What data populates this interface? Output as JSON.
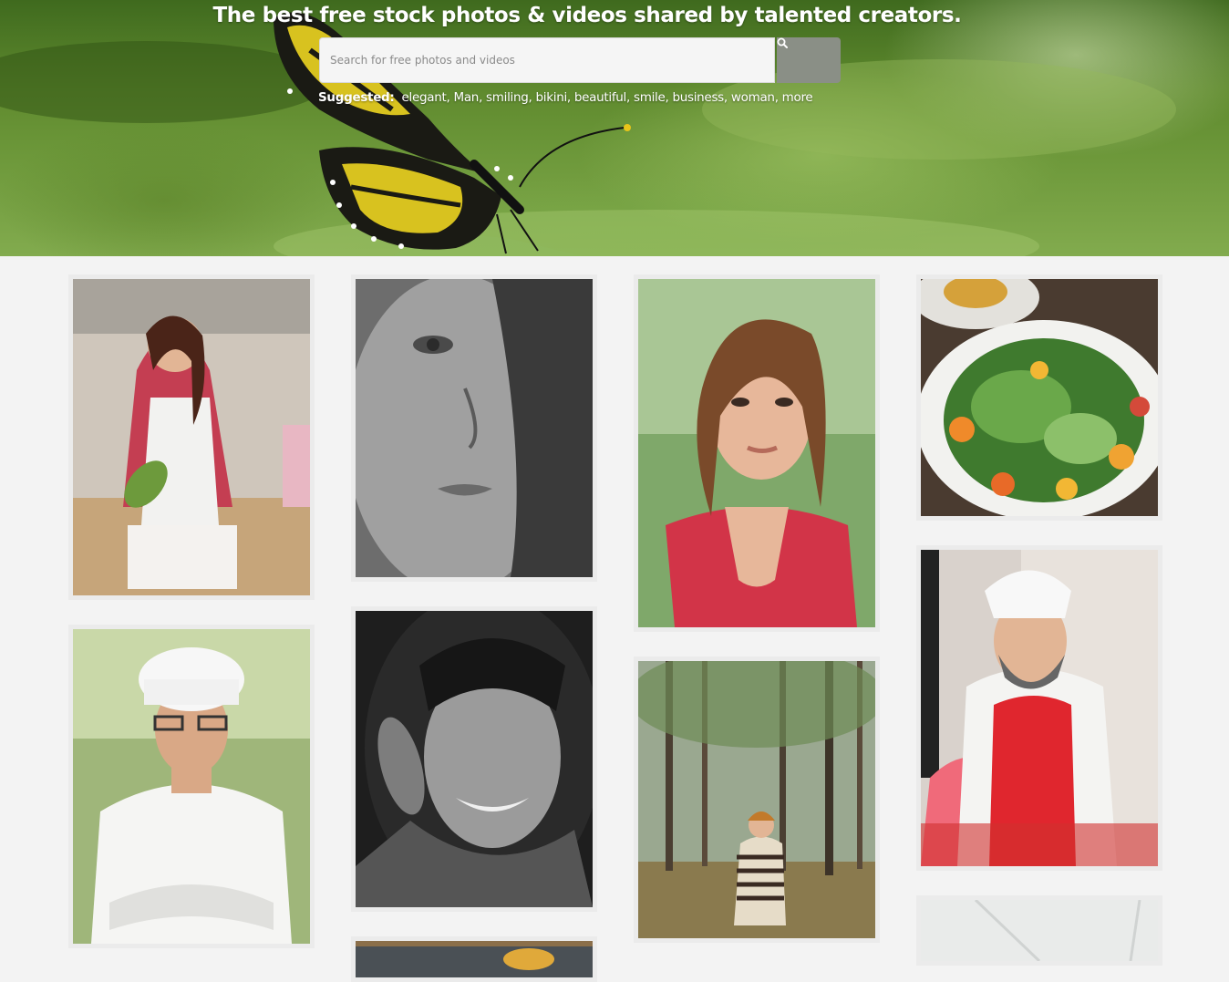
{
  "hero": {
    "title": "The best free stock photos & videos shared by talented creators.",
    "search": {
      "placeholder": "Search for free photos and videos",
      "value": "",
      "button_icon": "search-icon"
    },
    "suggested_label": "Suggested:",
    "suggestions": [
      "elegant",
      "Man",
      "smiling",
      "bikini",
      "beautiful",
      "smile",
      "business",
      "woman",
      "more"
    ]
  },
  "gallery": {
    "columns": [
      {
        "photos": [
          {
            "subject": "woman-baking-cake"
          },
          {
            "subject": "chef-arms-crossed"
          }
        ]
      },
      {
        "photos": [
          {
            "subject": "bw-woman-face-closeup"
          },
          {
            "subject": "bw-woman-smiling"
          },
          {
            "subject": "food-bowl-partial"
          }
        ]
      },
      {
        "photos": [
          {
            "subject": "woman-red-dress-portrait"
          },
          {
            "subject": "woman-in-forest"
          }
        ]
      },
      {
        "photos": [
          {
            "subject": "salad-plate"
          },
          {
            "subject": "chef-red-apron"
          },
          {
            "subject": "white-ceiling-partial"
          }
        ]
      }
    ]
  },
  "colors": {
    "page_bg": "#f3f3f3",
    "search_button": "#8a8f86",
    "text_light": "#ffffff"
  }
}
